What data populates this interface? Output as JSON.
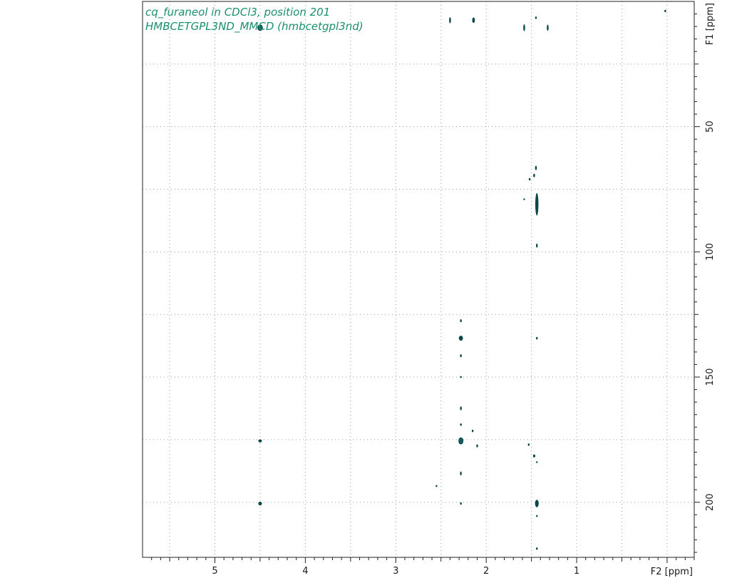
{
  "chart_data": {
    "type": "scatter",
    "title": "cq_furaneol in CDCl3, position 201",
    "subtitle": "HMBCETGPL3ND_MMCD (hmbcetgpl3nd)",
    "xlabel": "F2 [ppm]",
    "ylabel": "F1 [ppm]",
    "xlim": [
      5.8,
      -0.3
    ],
    "ylim": [
      0,
      222
    ],
    "x_reversed": true,
    "y_reversed": true,
    "x_ticks": [
      5,
      4,
      3,
      2,
      1
    ],
    "y_ticks": [
      50,
      100,
      150,
      200
    ],
    "grid": true,
    "contour_color": "#0a4848",
    "title_color": "#1a9070",
    "peaks": [
      {
        "x": 4.5,
        "y": 10.5,
        "w": 0.06,
        "h": 2.5
      },
      {
        "x": 2.4,
        "y": 7.5,
        "w": 0.02,
        "h": 2.5
      },
      {
        "x": 2.14,
        "y": 7.5,
        "w": 0.03,
        "h": 2.2
      },
      {
        "x": 1.58,
        "y": 10.5,
        "w": 0.02,
        "h": 2.8
      },
      {
        "x": 1.45,
        "y": 6.5,
        "w": 0.01,
        "h": 1
      },
      {
        "x": 1.32,
        "y": 10.5,
        "w": 0.02,
        "h": 2.5
      },
      {
        "x": 0.02,
        "y": 3.8,
        "w": 0.02,
        "h": 1
      },
      {
        "x": 1.45,
        "y": 66.5,
        "w": 0.02,
        "h": 1.8
      },
      {
        "x": 1.47,
        "y": 69.5,
        "w": 0.02,
        "h": 1.5
      },
      {
        "x": 1.52,
        "y": 71,
        "w": 0.015,
        "h": 1
      },
      {
        "x": 1.58,
        "y": 79,
        "w": 0.01,
        "h": 0.7
      },
      {
        "x": 1.44,
        "y": 81,
        "w": 0.035,
        "h": 9
      },
      {
        "x": 1.44,
        "y": 97.5,
        "w": 0.015,
        "h": 1.5
      },
      {
        "x": 2.28,
        "y": 127.5,
        "w": 0.015,
        "h": 1.2
      },
      {
        "x": 2.28,
        "y": 134.5,
        "w": 0.045,
        "h": 2
      },
      {
        "x": 1.44,
        "y": 134.5,
        "w": 0.015,
        "h": 1
      },
      {
        "x": 2.28,
        "y": 141.5,
        "w": 0.015,
        "h": 1.2
      },
      {
        "x": 2.28,
        "y": 150,
        "w": 0.008,
        "h": 0.8
      },
      {
        "x": 2.28,
        "y": 162.5,
        "w": 0.015,
        "h": 1.5
      },
      {
        "x": 2.28,
        "y": 169,
        "w": 0.008,
        "h": 1
      },
      {
        "x": 2.15,
        "y": 171.5,
        "w": 0.015,
        "h": 1
      },
      {
        "x": 2.28,
        "y": 175.5,
        "w": 0.055,
        "h": 2.8
      },
      {
        "x": 2.1,
        "y": 177.5,
        "w": 0.015,
        "h": 1.2
      },
      {
        "x": 4.5,
        "y": 175.5,
        "w": 0.04,
        "h": 1.2
      },
      {
        "x": 1.53,
        "y": 177,
        "w": 0.01,
        "h": 1
      },
      {
        "x": 1.47,
        "y": 181.5,
        "w": 0.025,
        "h": 1.2
      },
      {
        "x": 1.44,
        "y": 184,
        "w": 0.008,
        "h": 0.7
      },
      {
        "x": 2.28,
        "y": 188.5,
        "w": 0.015,
        "h": 1.5
      },
      {
        "x": 2.55,
        "y": 193.5,
        "w": 0.01,
        "h": 0.8
      },
      {
        "x": 4.5,
        "y": 200.5,
        "w": 0.04,
        "h": 1.5
      },
      {
        "x": 2.28,
        "y": 200.5,
        "w": 0.008,
        "h": 1
      },
      {
        "x": 1.44,
        "y": 200.5,
        "w": 0.04,
        "h": 3
      },
      {
        "x": 1.44,
        "y": 205.5,
        "w": 0.01,
        "h": 0.8
      },
      {
        "x": 1.44,
        "y": 218.5,
        "w": 0.01,
        "h": 1
      }
    ]
  }
}
